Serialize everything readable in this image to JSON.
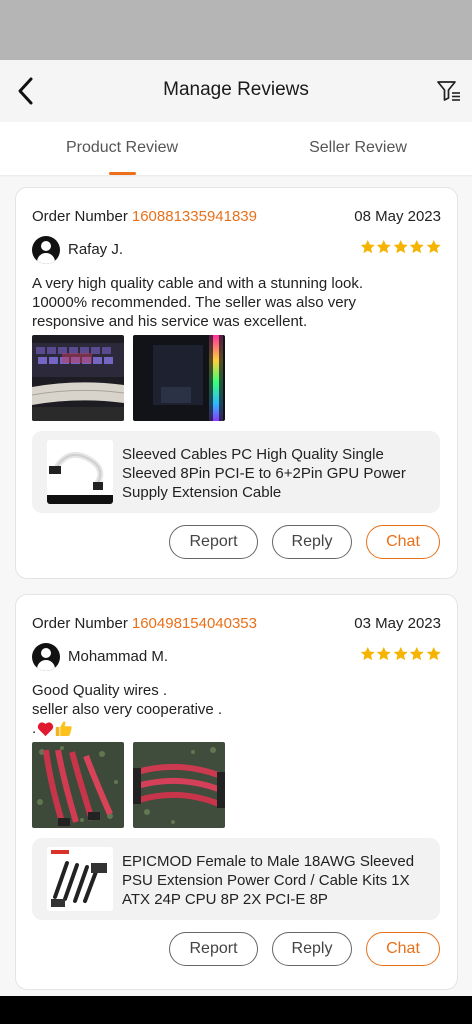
{
  "header": {
    "title": "Manage Reviews",
    "back_icon": "chevron-left-icon",
    "filter_icon": "filter-list-icon"
  },
  "tabs": [
    {
      "label": "Product Review",
      "active": true
    },
    {
      "label": "Seller Review",
      "active": false
    }
  ],
  "colors": {
    "accent": "#e8701a",
    "star": "#f5b400"
  },
  "reviews": [
    {
      "order_label": "Order Number",
      "order_number": "160881335941839",
      "date": "08 May 2023",
      "user": "Rafay J.",
      "rating": 5,
      "text_lines": [
        "A very high quality cable and with a stunning look.",
        "10000% recommended. The seller was also very",
        "responsive and his service was excellent."
      ],
      "product_name": "Sleeved Cables PC High Quality Single Sleeved 8Pin PCI-E to 6+2Pin GPU Power Supply Extension Cable",
      "actions": {
        "report": "Report",
        "reply": "Reply",
        "chat": "Chat"
      }
    },
    {
      "order_label": "Order Number",
      "order_number": "160498154040353",
      "date": "03 May 2023",
      "user": "Mohammad M.",
      "rating": 5,
      "text_lines": [
        "Good Quality wires .",
        "seller also very cooperative ."
      ],
      "emoji_prefix": ".",
      "emoji_icons": [
        "red-heart-icon",
        "thumbs-up-icon"
      ],
      "product_name": "EPICMOD Female to Male 18AWG Sleeved PSU Extension Power Cord / Cable Kits 1X ATX 24P CPU 8P 2X PCI-E 8P",
      "actions": {
        "report": "Report",
        "reply": "Reply",
        "chat": "Chat"
      }
    }
  ]
}
